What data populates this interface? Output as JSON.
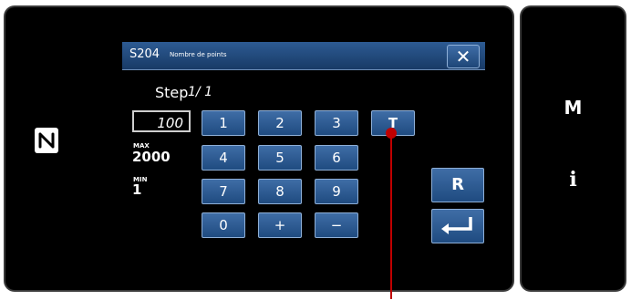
{
  "dialog": {
    "code": "S204",
    "title": "Nombre de points",
    "close_label": "✕"
  },
  "step": {
    "label": "Step",
    "value": "1/ 1"
  },
  "input": {
    "value": "100"
  },
  "limits": {
    "max_label": "MAX",
    "max_value": "2000",
    "min_label": "MIN",
    "min_value": "1"
  },
  "keypad": {
    "k1": "1",
    "k2": "2",
    "k3": "3",
    "kT": "T",
    "k4": "4",
    "k5": "5",
    "k6": "6",
    "k7": "7",
    "k8": "8",
    "k9": "9",
    "k0": "0",
    "kplus": "+",
    "kminus": "−"
  },
  "actions": {
    "reset_label": "R",
    "enter_label": "↵"
  },
  "side_panel": {
    "mode_label": "M",
    "info_label": "i"
  },
  "colors": {
    "accent": "#2d5b93",
    "callout": "#c00000"
  }
}
